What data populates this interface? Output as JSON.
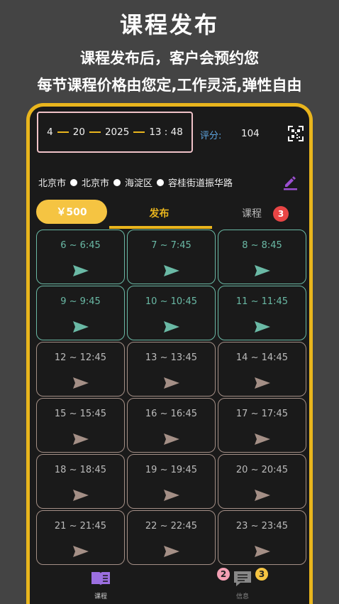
{
  "hero": {
    "title": "课程发布",
    "line1": "课程发布后，客户会预约您",
    "line2": "每节课程价格由您定,工作灵活,弹性自由"
  },
  "header": {
    "date": {
      "month": "4",
      "day": "20",
      "year": "2025",
      "time": "13 : 48"
    },
    "rating_label": "评分:",
    "rating_value": "104"
  },
  "address": [
    "北京市",
    "北京市",
    "海淀区",
    "容桂街道振华路"
  ],
  "price_button": "￥500",
  "tabs": {
    "publish": "发布",
    "course": "课程",
    "course_badge": "3"
  },
  "slots": [
    {
      "label": "6 ~ 6:45",
      "state": "active"
    },
    {
      "label": "7 ~ 7:45",
      "state": "active"
    },
    {
      "label": "8 ~ 8:45",
      "state": "active"
    },
    {
      "label": "9 ~ 9:45",
      "state": "active"
    },
    {
      "label": "10 ~ 10:45",
      "state": "active"
    },
    {
      "label": "11 ~ 11:45",
      "state": "active"
    },
    {
      "label": "12 ~ 12:45",
      "state": "past"
    },
    {
      "label": "13 ~ 13:45",
      "state": "past"
    },
    {
      "label": "14 ~ 14:45",
      "state": "past"
    },
    {
      "label": "15 ~ 15:45",
      "state": "past"
    },
    {
      "label": "16 ~ 16:45",
      "state": "past"
    },
    {
      "label": "17 ~ 17:45",
      "state": "past"
    },
    {
      "label": "18 ~ 18:45",
      "state": "past"
    },
    {
      "label": "19 ~ 19:45",
      "state": "past"
    },
    {
      "label": "20 ~ 20:45",
      "state": "past"
    },
    {
      "label": "21 ~ 21:45",
      "state": "past"
    },
    {
      "label": "22 ~ 22:45",
      "state": "past"
    },
    {
      "label": "23 ~ 23:45",
      "state": "past"
    }
  ],
  "bottom_nav": {
    "course_label": "课程",
    "info_label": "信息",
    "info_badge_left": "2",
    "info_badge_right": "3"
  },
  "colors": {
    "accent": "#e9b51d",
    "active_slot": "#6ab9a5",
    "past_slot": "#a48f86",
    "edit_icon": "#9b4fd0"
  }
}
